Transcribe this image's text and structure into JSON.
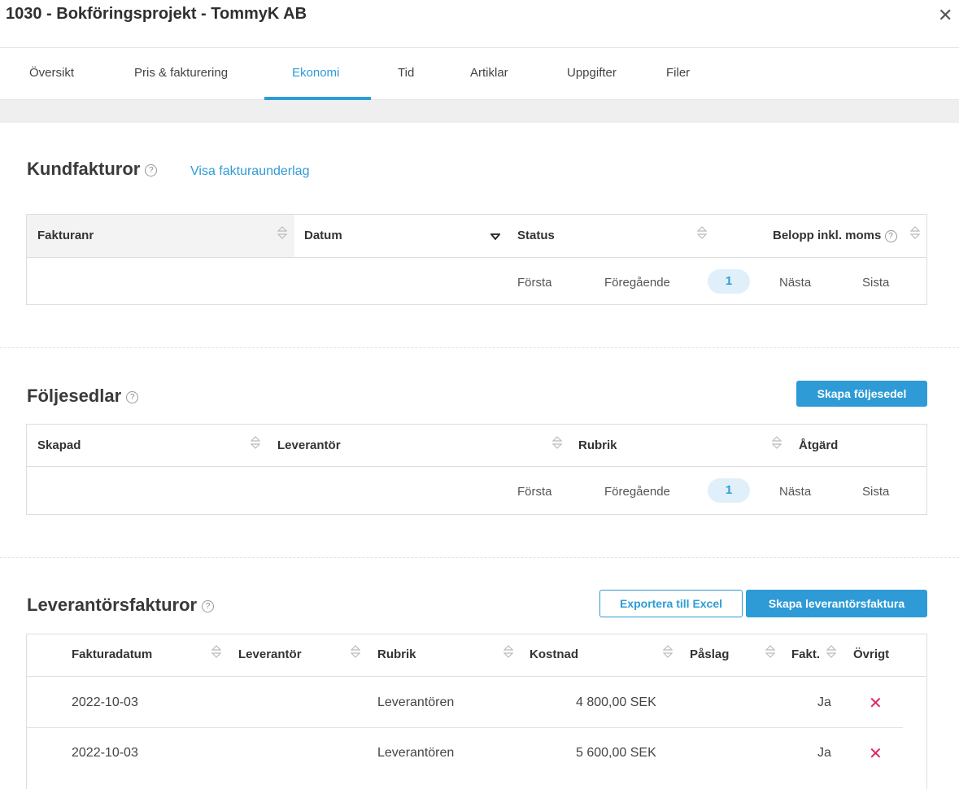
{
  "header": {
    "title": "1030 - Bokföringsprojekt - TommyK AB",
    "close_glyph": "✕"
  },
  "tabs": [
    {
      "label": "Översikt"
    },
    {
      "label": "Pris & fakturering"
    },
    {
      "label": "Ekonomi",
      "active": true
    },
    {
      "label": "Tid"
    },
    {
      "label": "Artiklar"
    },
    {
      "label": "Uppgifter"
    },
    {
      "label": "Filer"
    }
  ],
  "kundfakturor": {
    "title": "Kundfakturor",
    "link": "Visa fakturaunderlag",
    "columns": [
      "Fakturanr",
      "Datum",
      "Status",
      "Belopp inkl. moms"
    ],
    "pager": {
      "first": "Första",
      "prev": "Föregående",
      "current": "1",
      "next": "Nästa",
      "last": "Sista"
    }
  },
  "foljesedlar": {
    "title": "Följesedlar",
    "button": "Skapa följesedel",
    "columns": [
      "Skapad",
      "Leverantör",
      "Rubrik",
      "Åtgärd"
    ],
    "pager": {
      "first": "Första",
      "prev": "Föregående",
      "current": "1",
      "next": "Nästa",
      "last": "Sista"
    }
  },
  "leverantorsfakturor": {
    "title": "Leverantörsfakturor",
    "export_button": "Exportera till Excel",
    "create_button": "Skapa leverantörsfaktura",
    "columns": [
      "Fakturadatum",
      "Leverantör",
      "Rubrik",
      "Kostnad",
      "Påslag",
      "Fakt.",
      "Övrigt"
    ],
    "rows": [
      {
        "date": "2022-10-03",
        "supplier": "",
        "subject": "Leverantören",
        "cost": "4 800,00 SEK",
        "markup": "",
        "invoiced": "Ja"
      },
      {
        "date": "2022-10-03",
        "supplier": "",
        "subject": "Leverantören",
        "cost": "5 600,00 SEK",
        "markup": "",
        "invoiced": "Ja"
      }
    ]
  },
  "help_glyph": "?",
  "delete_glyph": "✕",
  "colors": {
    "accent": "#2e9bd6",
    "danger": "#e0245e",
    "band": "#efefef"
  }
}
